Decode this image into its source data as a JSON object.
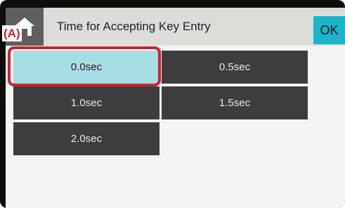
{
  "header": {
    "home_icon": "home-icon",
    "title": "Time for Accepting Key Entry",
    "ok_label": "OK"
  },
  "options": [
    {
      "label": "0.0sec",
      "selected": true
    },
    {
      "label": "0.5sec",
      "selected": false
    },
    {
      "label": "1.0sec",
      "selected": false
    },
    {
      "label": "1.5sec",
      "selected": false
    },
    {
      "label": "2.0sec",
      "selected": false
    }
  ],
  "annotation": {
    "label": "(A)"
  },
  "colors": {
    "selected": "#a7dde4",
    "unselected": "#3d3d3d",
    "ok": "#1bb4c9",
    "highlight": "#cc2233"
  }
}
